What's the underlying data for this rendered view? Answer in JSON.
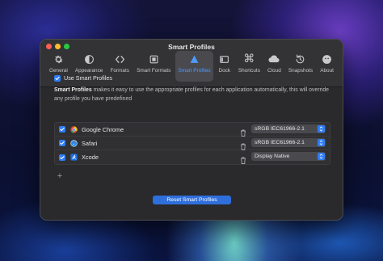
{
  "window": {
    "title": "Smart Profiles"
  },
  "toolbar": {
    "items": [
      {
        "label": "General",
        "icon": "gear-icon"
      },
      {
        "label": "Appearance",
        "icon": "appearance-icon"
      },
      {
        "label": "Formats",
        "icon": "formats-icon"
      },
      {
        "label": "Smart Formats",
        "icon": "smart-formats-icon"
      },
      {
        "label": "Smart Profiles",
        "icon": "smart-profiles-icon",
        "active": true
      },
      {
        "label": "Dock",
        "icon": "dock-icon"
      },
      {
        "label": "Shortcuts",
        "icon": "command-icon"
      },
      {
        "label": "Cloud",
        "icon": "cloud-icon"
      },
      {
        "label": "Snapshots",
        "icon": "snapshots-icon"
      },
      {
        "label": "About",
        "icon": "about-icon"
      }
    ]
  },
  "settings": {
    "use_smart_profiles_label": "Use Smart Profiles",
    "use_smart_profiles_checked": true,
    "description_bold": "Smart Profiles",
    "description_rest": " makes it easy to use the appropriate profiles for each application automatically, this will override any profile you have predefined"
  },
  "apps": [
    {
      "name": "Google Chrome",
      "profile": "sRGB IEC61966-2.1",
      "checked": true,
      "icon": "chrome-icon"
    },
    {
      "name": "Safari",
      "profile": "sRGB IEC61966-2.1",
      "checked": true,
      "icon": "safari-icon"
    },
    {
      "name": "Xcode",
      "profile": "Display Native",
      "checked": true,
      "icon": "xcode-icon"
    }
  ],
  "actions": {
    "add_symbol": "+",
    "reset_label": "Reset Smart Profiles"
  },
  "colors": {
    "accent": "#2f7df6",
    "active_tab_label": "#4f9bff",
    "window_bg": "#2a2a2c"
  }
}
